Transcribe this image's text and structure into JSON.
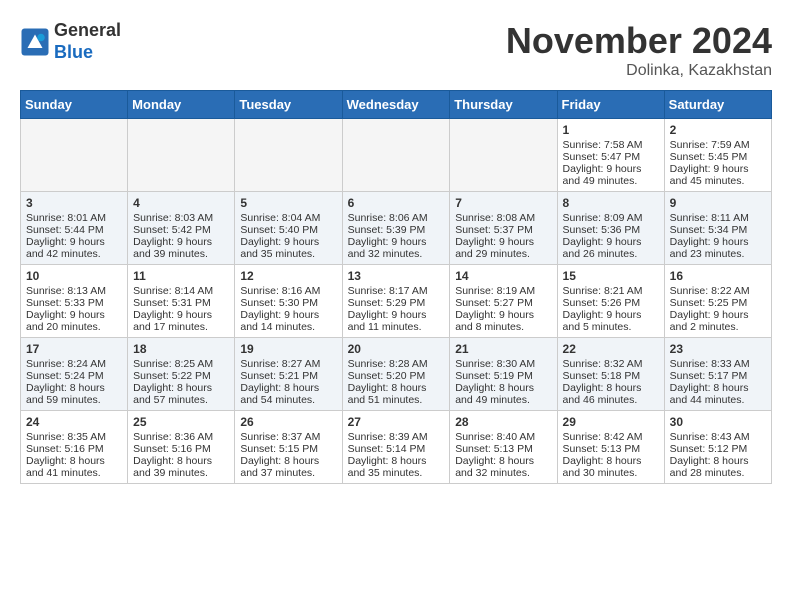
{
  "header": {
    "logo_line1": "General",
    "logo_line2": "Blue",
    "month_title": "November 2024",
    "location": "Dolinka, Kazakhstan"
  },
  "weekdays": [
    "Sunday",
    "Monday",
    "Tuesday",
    "Wednesday",
    "Thursday",
    "Friday",
    "Saturday"
  ],
  "weeks": [
    [
      {
        "day": "",
        "info": ""
      },
      {
        "day": "",
        "info": ""
      },
      {
        "day": "",
        "info": ""
      },
      {
        "day": "",
        "info": ""
      },
      {
        "day": "",
        "info": ""
      },
      {
        "day": "1",
        "info": "Sunrise: 7:58 AM\nSunset: 5:47 PM\nDaylight: 9 hours and 49 minutes."
      },
      {
        "day": "2",
        "info": "Sunrise: 7:59 AM\nSunset: 5:45 PM\nDaylight: 9 hours and 45 minutes."
      }
    ],
    [
      {
        "day": "3",
        "info": "Sunrise: 8:01 AM\nSunset: 5:44 PM\nDaylight: 9 hours and 42 minutes."
      },
      {
        "day": "4",
        "info": "Sunrise: 8:03 AM\nSunset: 5:42 PM\nDaylight: 9 hours and 39 minutes."
      },
      {
        "day": "5",
        "info": "Sunrise: 8:04 AM\nSunset: 5:40 PM\nDaylight: 9 hours and 35 minutes."
      },
      {
        "day": "6",
        "info": "Sunrise: 8:06 AM\nSunset: 5:39 PM\nDaylight: 9 hours and 32 minutes."
      },
      {
        "day": "7",
        "info": "Sunrise: 8:08 AM\nSunset: 5:37 PM\nDaylight: 9 hours and 29 minutes."
      },
      {
        "day": "8",
        "info": "Sunrise: 8:09 AM\nSunset: 5:36 PM\nDaylight: 9 hours and 26 minutes."
      },
      {
        "day": "9",
        "info": "Sunrise: 8:11 AM\nSunset: 5:34 PM\nDaylight: 9 hours and 23 minutes."
      }
    ],
    [
      {
        "day": "10",
        "info": "Sunrise: 8:13 AM\nSunset: 5:33 PM\nDaylight: 9 hours and 20 minutes."
      },
      {
        "day": "11",
        "info": "Sunrise: 8:14 AM\nSunset: 5:31 PM\nDaylight: 9 hours and 17 minutes."
      },
      {
        "day": "12",
        "info": "Sunrise: 8:16 AM\nSunset: 5:30 PM\nDaylight: 9 hours and 14 minutes."
      },
      {
        "day": "13",
        "info": "Sunrise: 8:17 AM\nSunset: 5:29 PM\nDaylight: 9 hours and 11 minutes."
      },
      {
        "day": "14",
        "info": "Sunrise: 8:19 AM\nSunset: 5:27 PM\nDaylight: 9 hours and 8 minutes."
      },
      {
        "day": "15",
        "info": "Sunrise: 8:21 AM\nSunset: 5:26 PM\nDaylight: 9 hours and 5 minutes."
      },
      {
        "day": "16",
        "info": "Sunrise: 8:22 AM\nSunset: 5:25 PM\nDaylight: 9 hours and 2 minutes."
      }
    ],
    [
      {
        "day": "17",
        "info": "Sunrise: 8:24 AM\nSunset: 5:24 PM\nDaylight: 8 hours and 59 minutes."
      },
      {
        "day": "18",
        "info": "Sunrise: 8:25 AM\nSunset: 5:22 PM\nDaylight: 8 hours and 57 minutes."
      },
      {
        "day": "19",
        "info": "Sunrise: 8:27 AM\nSunset: 5:21 PM\nDaylight: 8 hours and 54 minutes."
      },
      {
        "day": "20",
        "info": "Sunrise: 8:28 AM\nSunset: 5:20 PM\nDaylight: 8 hours and 51 minutes."
      },
      {
        "day": "21",
        "info": "Sunrise: 8:30 AM\nSunset: 5:19 PM\nDaylight: 8 hours and 49 minutes."
      },
      {
        "day": "22",
        "info": "Sunrise: 8:32 AM\nSunset: 5:18 PM\nDaylight: 8 hours and 46 minutes."
      },
      {
        "day": "23",
        "info": "Sunrise: 8:33 AM\nSunset: 5:17 PM\nDaylight: 8 hours and 44 minutes."
      }
    ],
    [
      {
        "day": "24",
        "info": "Sunrise: 8:35 AM\nSunset: 5:16 PM\nDaylight: 8 hours and 41 minutes."
      },
      {
        "day": "25",
        "info": "Sunrise: 8:36 AM\nSunset: 5:16 PM\nDaylight: 8 hours and 39 minutes."
      },
      {
        "day": "26",
        "info": "Sunrise: 8:37 AM\nSunset: 5:15 PM\nDaylight: 8 hours and 37 minutes."
      },
      {
        "day": "27",
        "info": "Sunrise: 8:39 AM\nSunset: 5:14 PM\nDaylight: 8 hours and 35 minutes."
      },
      {
        "day": "28",
        "info": "Sunrise: 8:40 AM\nSunset: 5:13 PM\nDaylight: 8 hours and 32 minutes."
      },
      {
        "day": "29",
        "info": "Sunrise: 8:42 AM\nSunset: 5:13 PM\nDaylight: 8 hours and 30 minutes."
      },
      {
        "day": "30",
        "info": "Sunrise: 8:43 AM\nSunset: 5:12 PM\nDaylight: 8 hours and 28 minutes."
      }
    ]
  ]
}
